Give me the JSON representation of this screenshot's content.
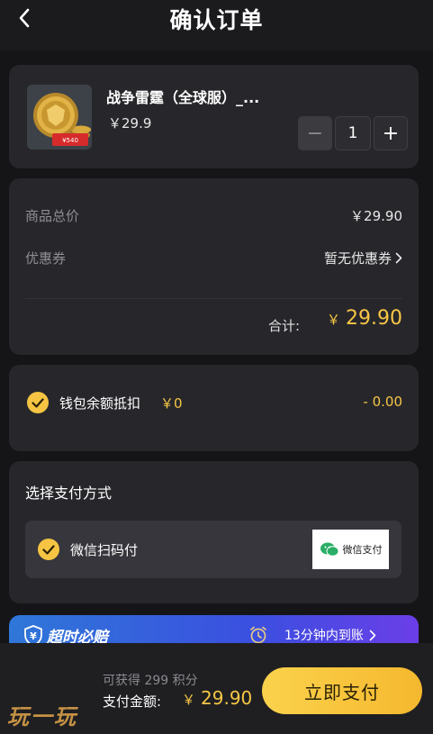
{
  "header": {
    "title": "确认订单"
  },
  "product": {
    "name": "战争雷霆（全球服）_...",
    "price": "￥29.9",
    "quantity": "1",
    "minus_label": "−",
    "plus_label": "+",
    "thumb_badge": "¥540"
  },
  "pricing": {
    "subtotal_label": "商品总价",
    "subtotal_value": "￥29.90",
    "coupon_label": "优惠券",
    "coupon_value": "暂无优惠券",
    "total_label": "合计:",
    "total_currency": "￥",
    "total_value": "29.90"
  },
  "wallet": {
    "label": "钱包余额抵扣",
    "balance": "￥0",
    "deduction": "- 0.00",
    "checked": true
  },
  "payment": {
    "title": "选择支付方式",
    "selected_option": "微信扫码付",
    "badge_text": "微信支付"
  },
  "promo": {
    "title": "超时必赔",
    "text": "13分钟内到账"
  },
  "footer": {
    "points": "可获得 299 积分",
    "pay_label": "支付金额:",
    "currency": "￥",
    "pay_amount": "29.90",
    "pay_button": "立即支付",
    "watermark": "玩一玩"
  },
  "colors": {
    "accent": "#f7c646",
    "background": "#151518",
    "card": "#27272b",
    "promo_start": "#2f77d8",
    "promo_end": "#6b3ee8"
  }
}
